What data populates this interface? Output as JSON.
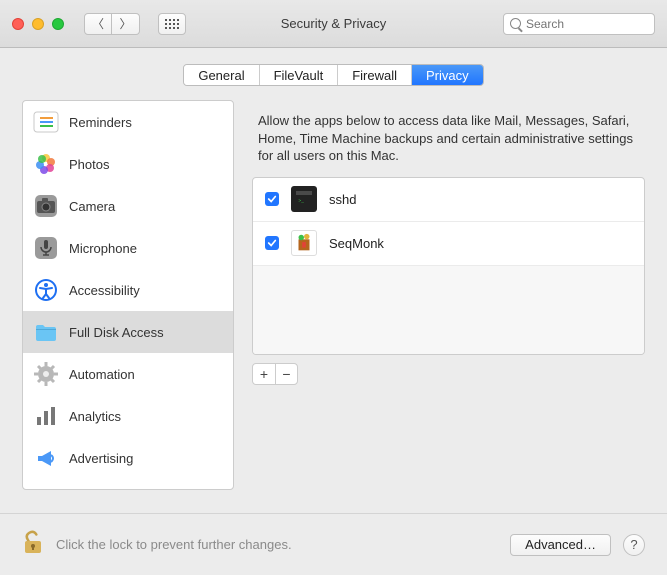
{
  "window": {
    "title": "Security & Privacy"
  },
  "search": {
    "placeholder": "Search"
  },
  "tabs": {
    "general": "General",
    "filevault": "FileVault",
    "firewall": "Firewall",
    "privacy": "Privacy"
  },
  "sidebar": {
    "reminders": "Reminders",
    "photos": "Photos",
    "camera": "Camera",
    "microphone": "Microphone",
    "accessibility": "Accessibility",
    "full_disk_access": "Full Disk Access",
    "automation": "Automation",
    "analytics": "Analytics",
    "advertising": "Advertising"
  },
  "right": {
    "description": "Allow the apps below to access data like Mail, Messages, Safari, Home, Time Machine backups and certain administrative settings for all users on this Mac.",
    "apps": {
      "sshd": "sshd",
      "seqmonk": "SeqMonk"
    },
    "add": "+",
    "remove": "−"
  },
  "footer": {
    "lock_text": "Click the lock to prevent further changes.",
    "advanced": "Advanced…",
    "help": "?"
  }
}
